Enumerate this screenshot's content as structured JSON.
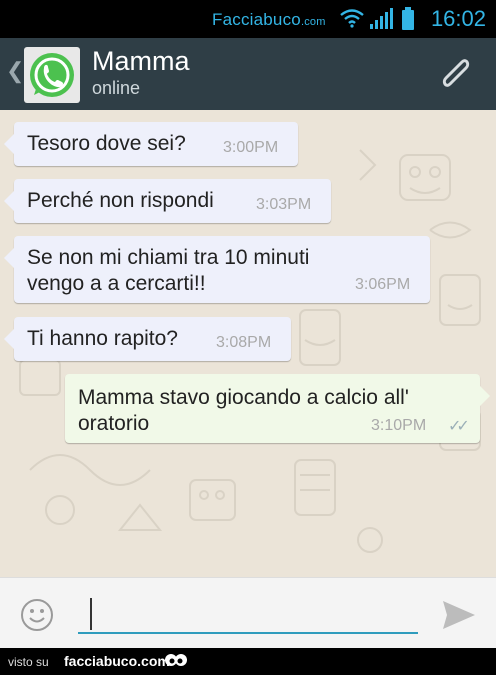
{
  "status_bar": {
    "brand_main": "Facciabuco",
    "brand_suffix": ".com",
    "time": "16:02",
    "icons": [
      "wifi-icon",
      "signal-icon",
      "battery-icon"
    ]
  },
  "header": {
    "back_icon": "chevron-left-icon",
    "avatar_icon": "whatsapp-logo-icon",
    "contact_name": "Mamma",
    "contact_status": "online",
    "attach_icon": "paperclip-icon"
  },
  "messages": [
    {
      "direction": "in",
      "text": "Tesoro dove sei?",
      "time": "3:00PM"
    },
    {
      "direction": "in",
      "text": "Perché non rispondi",
      "time": "3:03PM"
    },
    {
      "direction": "in",
      "text": "Se non mi chiami tra 10 minuti\nvengo a a cercarti!!",
      "time": "3:06PM"
    },
    {
      "direction": "in",
      "text": "Ti hanno rapito?",
      "time": "3:08PM"
    },
    {
      "direction": "out",
      "text": "Mamma stavo giocando a calcio all'\noratorio",
      "time": "3:10PM",
      "status_icon": "double-check-icon"
    }
  ],
  "composer": {
    "emoji_icon": "smiley-icon",
    "value": "",
    "send_icon": "send-icon"
  },
  "footer": {
    "prefix": "visto su",
    "brand": "facciabuco.com"
  },
  "colors": {
    "status_bar": "#000000",
    "header": "#2f3e46",
    "incoming_bubble": "#eef0fb",
    "outgoing_bubble": "#f1f9e8",
    "accent": "#33b5e5",
    "input_underline": "#2f9cbd"
  }
}
